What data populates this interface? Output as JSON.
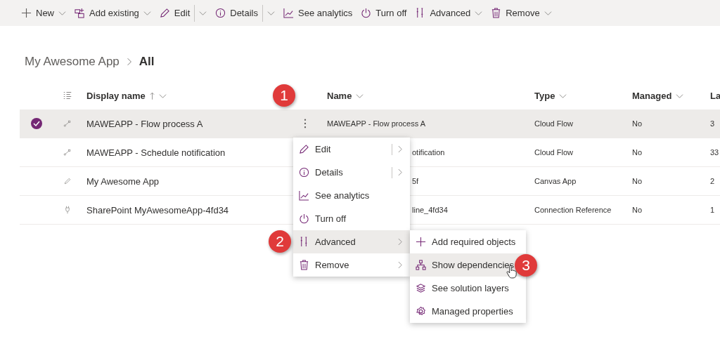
{
  "toolbar": [
    {
      "label": "New",
      "has_menu": true,
      "split": false
    },
    {
      "label": "Add existing",
      "has_menu": true,
      "split": false
    },
    {
      "label": "Edit",
      "has_menu": true,
      "split": true
    },
    {
      "label": "Details",
      "has_menu": true,
      "split": true
    },
    {
      "label": "See analytics",
      "has_menu": false
    },
    {
      "label": "Turn off",
      "has_menu": false
    },
    {
      "label": "Advanced",
      "has_menu": true,
      "split": false
    },
    {
      "label": "Remove",
      "has_menu": true,
      "split": false
    }
  ],
  "breadcrumb": {
    "parent": "My Awesome App",
    "current": "All"
  },
  "table": {
    "columns": [
      "Display name",
      "Name",
      "Type",
      "Managed",
      "La"
    ],
    "rows": [
      {
        "selected": true,
        "covered": false,
        "cells": [
          "MAWEAPP - Flow process A",
          "MAWEAPP - Flow process A",
          "Cloud Flow",
          "No",
          "3"
        ]
      },
      {
        "selected": false,
        "covered": true,
        "cells": [
          "MAWEAPP - Schedule notification",
          "otification",
          "Cloud Flow",
          "No",
          "33"
        ]
      },
      {
        "selected": false,
        "covered": true,
        "cells": [
          "My Awesome App",
          "5f",
          "Canvas App",
          "No",
          "2"
        ]
      },
      {
        "selected": false,
        "covered": true,
        "cells": [
          "SharePoint MyAwesomeApp-4fd34",
          "line_4fd34",
          "Connection Reference",
          "No",
          "1"
        ]
      }
    ]
  },
  "context_menu": {
    "items": [
      {
        "label": "Edit",
        "kind": "split",
        "selected": false
      },
      {
        "label": "Details",
        "kind": "split",
        "selected": false
      },
      {
        "label": "See analytics",
        "kind": "plain",
        "selected": false
      },
      {
        "label": "Turn off",
        "kind": "plain",
        "selected": false
      },
      {
        "label": "Advanced",
        "kind": "submenu",
        "selected": true
      },
      {
        "label": "Remove",
        "kind": "submenu",
        "selected": false
      }
    ]
  },
  "submenu": {
    "items": [
      {
        "label": "Add required objects",
        "selected": false
      },
      {
        "label": "Show dependencies",
        "selected": true
      },
      {
        "label": "See solution layers",
        "selected": false
      },
      {
        "label": "Managed properties",
        "selected": false
      }
    ]
  },
  "callouts": [
    "1",
    "2",
    "3"
  ]
}
